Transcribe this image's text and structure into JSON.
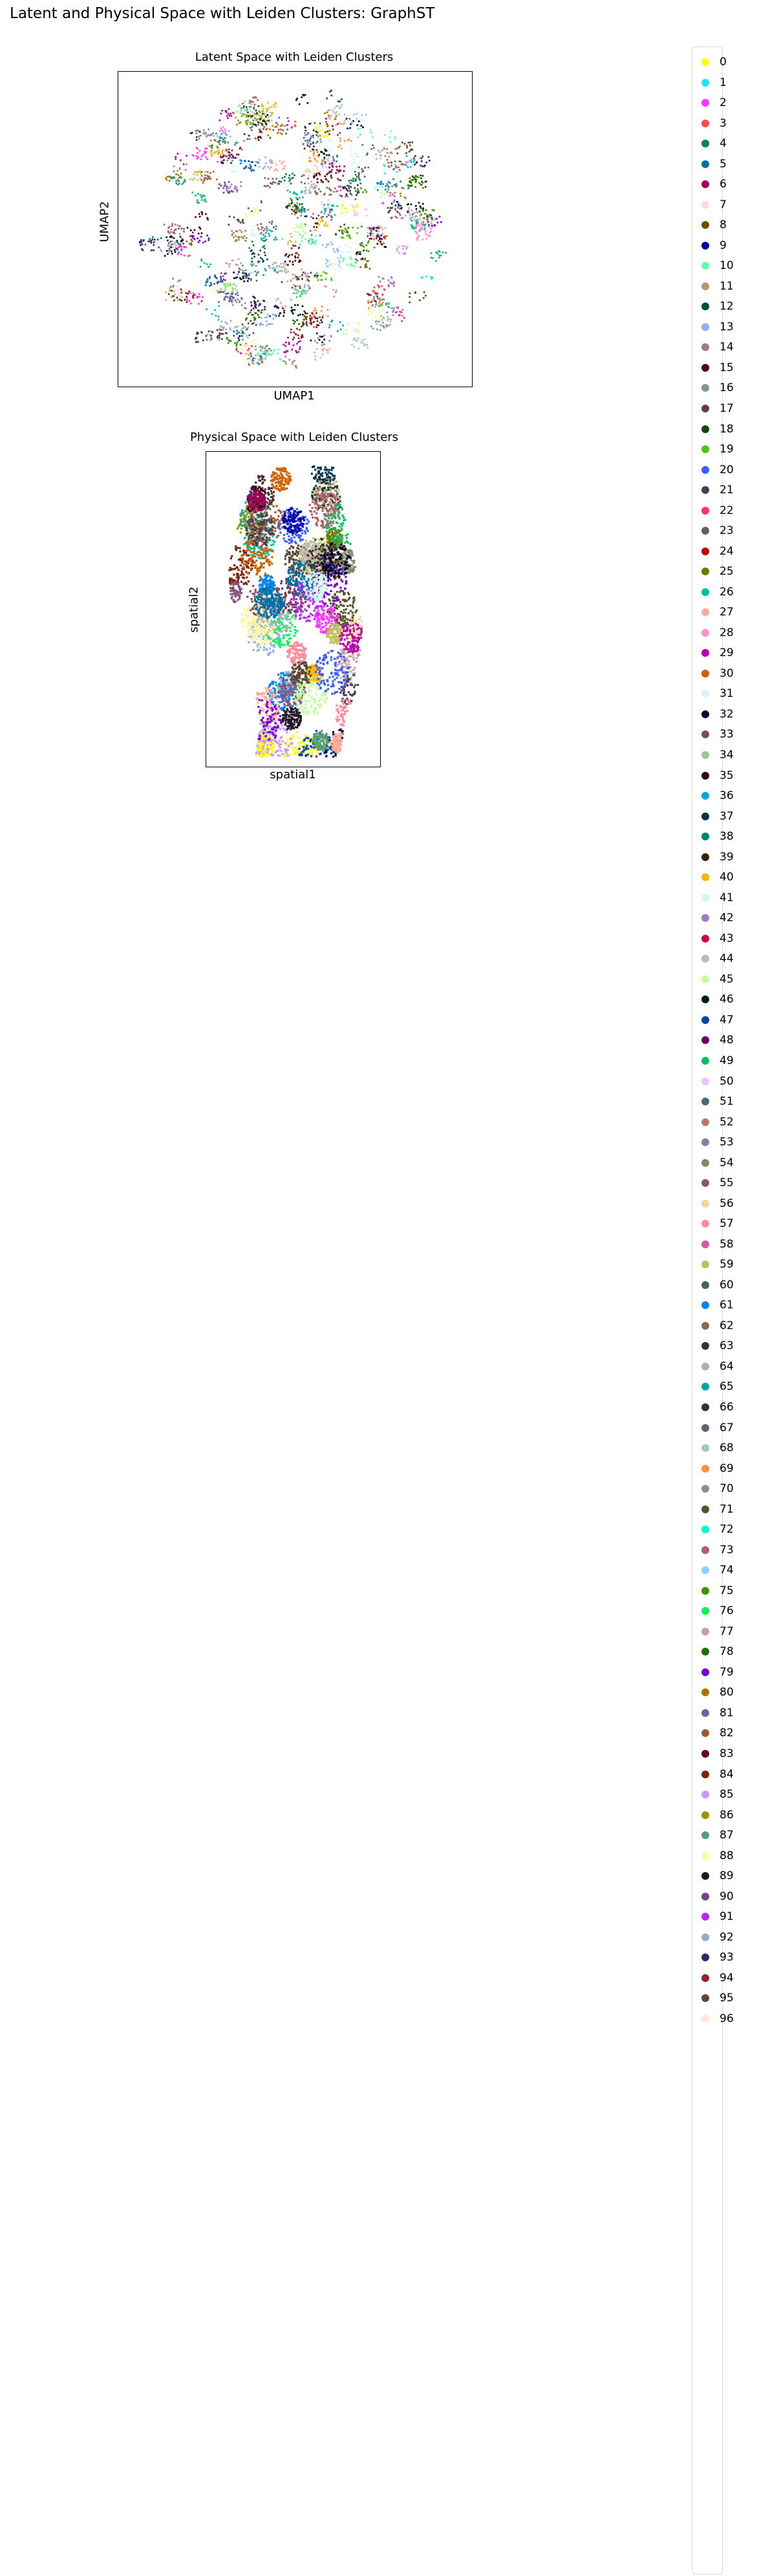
{
  "figure": {
    "title": "Latent and Physical Space with Leiden Clusters: GraphST"
  },
  "chart_data": [
    {
      "type": "scatter",
      "title": "Latent Space with Leiden Clusters",
      "xlabel": "UMAP1",
      "ylabel": "UMAP2",
      "ticks": "none",
      "grid": false,
      "legend": "shared, right"
    },
    {
      "type": "scatter",
      "title": "Physical Space with Leiden Clusters",
      "xlabel": "spatial1",
      "ylabel": "spatial2",
      "ticks": "none",
      "grid": false,
      "legend": "shared, right"
    }
  ],
  "legend": {
    "entries": [
      {
        "label": "0",
        "color": "#ffff00"
      },
      {
        "label": "1",
        "color": "#1ce6ff"
      },
      {
        "label": "2",
        "color": "#ff34ff"
      },
      {
        "label": "3",
        "color": "#ff4a46"
      },
      {
        "label": "4",
        "color": "#008941"
      },
      {
        "label": "5",
        "color": "#006fa6"
      },
      {
        "label": "6",
        "color": "#a30059"
      },
      {
        "label": "7",
        "color": "#ffdbe5"
      },
      {
        "label": "8",
        "color": "#7a4900"
      },
      {
        "label": "9",
        "color": "#0000a6"
      },
      {
        "label": "10",
        "color": "#63ffac"
      },
      {
        "label": "11",
        "color": "#b79762"
      },
      {
        "label": "12",
        "color": "#004d43"
      },
      {
        "label": "13",
        "color": "#8fb0ff"
      },
      {
        "label": "14",
        "color": "#997d87"
      },
      {
        "label": "15",
        "color": "#5a0007"
      },
      {
        "label": "16",
        "color": "#809693"
      },
      {
        "label": "17",
        "color": "#6a3a4c"
      },
      {
        "label": "18",
        "color": "#1b4400"
      },
      {
        "label": "19",
        "color": "#4fc601"
      },
      {
        "label": "20",
        "color": "#3b5dff"
      },
      {
        "label": "21",
        "color": "#4a3b53"
      },
      {
        "label": "22",
        "color": "#ff2f80"
      },
      {
        "label": "23",
        "color": "#61615a"
      },
      {
        "label": "24",
        "color": "#ba0900"
      },
      {
        "label": "25",
        "color": "#6b7900"
      },
      {
        "label": "26",
        "color": "#00c2a0"
      },
      {
        "label": "27",
        "color": "#ffaa92"
      },
      {
        "label": "28",
        "color": "#ff90c9"
      },
      {
        "label": "29",
        "color": "#b903aa"
      },
      {
        "label": "30",
        "color": "#d16100"
      },
      {
        "label": "31",
        "color": "#ddefff"
      },
      {
        "label": "32",
        "color": "#000035"
      },
      {
        "label": "33",
        "color": "#7b4f4b"
      },
      {
        "label": "34",
        "color": "#a1c299"
      },
      {
        "label": "35",
        "color": "#300018"
      },
      {
        "label": "36",
        "color": "#0aa6d8"
      },
      {
        "label": "37",
        "color": "#013349"
      },
      {
        "label": "38",
        "color": "#00846f"
      },
      {
        "label": "39",
        "color": "#372101"
      },
      {
        "label": "40",
        "color": "#ffb500"
      },
      {
        "label": "41",
        "color": "#c2ffed"
      },
      {
        "label": "42",
        "color": "#a079bf"
      },
      {
        "label": "43",
        "color": "#cc0744"
      },
      {
        "label": "44",
        "color": "#c0b9b2"
      },
      {
        "label": "45",
        "color": "#c2ff99"
      },
      {
        "label": "46",
        "color": "#001e09"
      },
      {
        "label": "47",
        "color": "#00489c"
      },
      {
        "label": "48",
        "color": "#6f0062"
      },
      {
        "label": "49",
        "color": "#0cbd66"
      },
      {
        "label": "50",
        "color": "#eec3ff"
      },
      {
        "label": "51",
        "color": "#456d75"
      },
      {
        "label": "52",
        "color": "#b77b68"
      },
      {
        "label": "53",
        "color": "#7a87a1"
      },
      {
        "label": "54",
        "color": "#788d66"
      },
      {
        "label": "55",
        "color": "#885578"
      },
      {
        "label": "56",
        "color": "#fad09f"
      },
      {
        "label": "57",
        "color": "#ff8a9a"
      },
      {
        "label": "58",
        "color": "#d157a0"
      },
      {
        "label": "59",
        "color": "#bec459"
      },
      {
        "label": "60",
        "color": "#456648"
      },
      {
        "label": "61",
        "color": "#0086ed"
      },
      {
        "label": "62",
        "color": "#886f4c"
      },
      {
        "label": "63",
        "color": "#34362d"
      },
      {
        "label": "64",
        "color": "#b4a8bd"
      },
      {
        "label": "65",
        "color": "#00a6aa"
      },
      {
        "label": "66",
        "color": "#452c2c"
      },
      {
        "label": "67",
        "color": "#636375"
      },
      {
        "label": "68",
        "color": "#a3c8c9"
      },
      {
        "label": "69",
        "color": "#ff913f"
      },
      {
        "label": "70",
        "color": "#938a81"
      },
      {
        "label": "71",
        "color": "#575329"
      },
      {
        "label": "72",
        "color": "#00fecf"
      },
      {
        "label": "73",
        "color": "#b05b6f"
      },
      {
        "label": "74",
        "color": "#8cd0ff"
      },
      {
        "label": "75",
        "color": "#3b9700"
      },
      {
        "label": "76",
        "color": "#04f757"
      },
      {
        "label": "77",
        "color": "#c8a1a1"
      },
      {
        "label": "78",
        "color": "#1e6e00"
      },
      {
        "label": "79",
        "color": "#7900d7"
      },
      {
        "label": "80",
        "color": "#a77500"
      },
      {
        "label": "81",
        "color": "#6367a9"
      },
      {
        "label": "82",
        "color": "#a05837"
      },
      {
        "label": "83",
        "color": "#6b002c"
      },
      {
        "label": "84",
        "color": "#772600"
      },
      {
        "label": "85",
        "color": "#d790ff"
      },
      {
        "label": "86",
        "color": "#9b9700"
      },
      {
        "label": "87",
        "color": "#549e79"
      },
      {
        "label": "88",
        "color": "#fff69f"
      },
      {
        "label": "89",
        "color": "#201625"
      },
      {
        "label": "90",
        "color": "#72418f"
      },
      {
        "label": "91",
        "color": "#bc23ff"
      },
      {
        "label": "92",
        "color": "#99adc0"
      },
      {
        "label": "93",
        "color": "#3a2465"
      },
      {
        "label": "94",
        "color": "#922329"
      },
      {
        "label": "95",
        "color": "#5b4534"
      },
      {
        "label": "96",
        "color": "#fde8dc"
      }
    ]
  }
}
